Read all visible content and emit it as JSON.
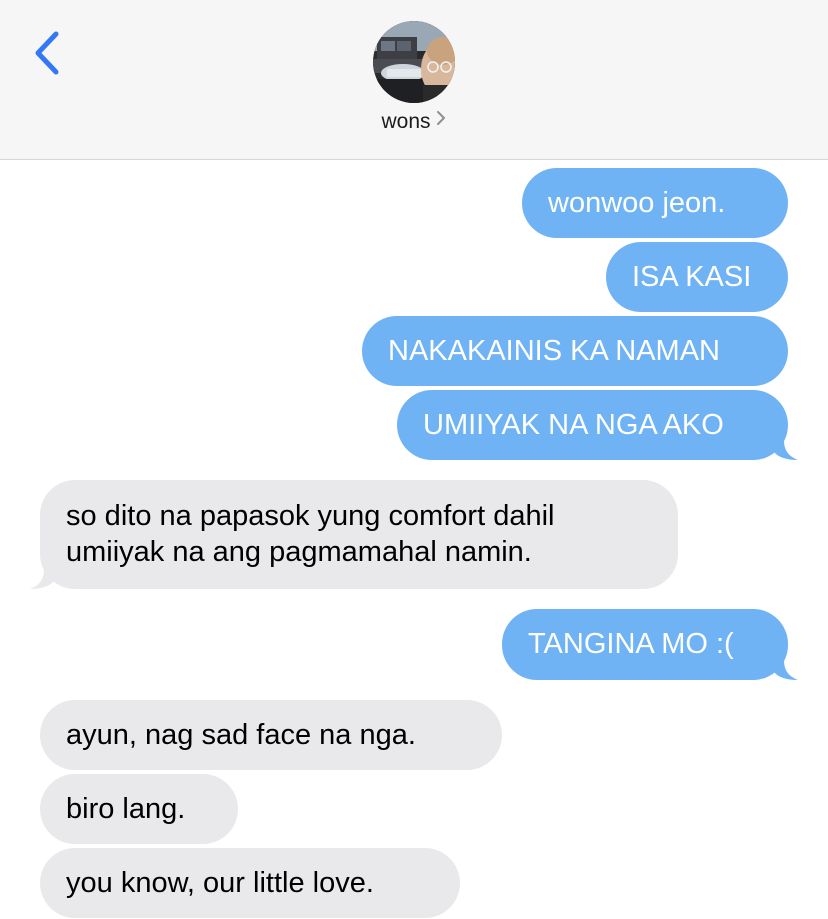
{
  "header": {
    "contact_name": "wons",
    "accent": "#3478f6"
  },
  "colors": {
    "sent_bubble": "#6fb3f5",
    "received_bubble": "#e9e9eb",
    "header_bg": "#f6f6f6"
  },
  "messages": [
    {
      "from": "me",
      "text": "wonwoo jeon."
    },
    {
      "from": "me",
      "text": "ISA KASI"
    },
    {
      "from": "me",
      "text": "NAKAKAINIS KA NAMAN"
    },
    {
      "from": "me",
      "text": "UMIIYAK NA NGA AKO"
    },
    {
      "from": "them",
      "line1": "so dito na papasok yung comfort dahil",
      "line2": "umiiyak na ang pagmamahal namin."
    },
    {
      "from": "me",
      "text": "TANGINA MO :("
    },
    {
      "from": "them",
      "text": "ayun, nag sad face na nga."
    },
    {
      "from": "them",
      "text": "biro lang."
    },
    {
      "from": "them",
      "text": "you know, our little love."
    }
  ]
}
